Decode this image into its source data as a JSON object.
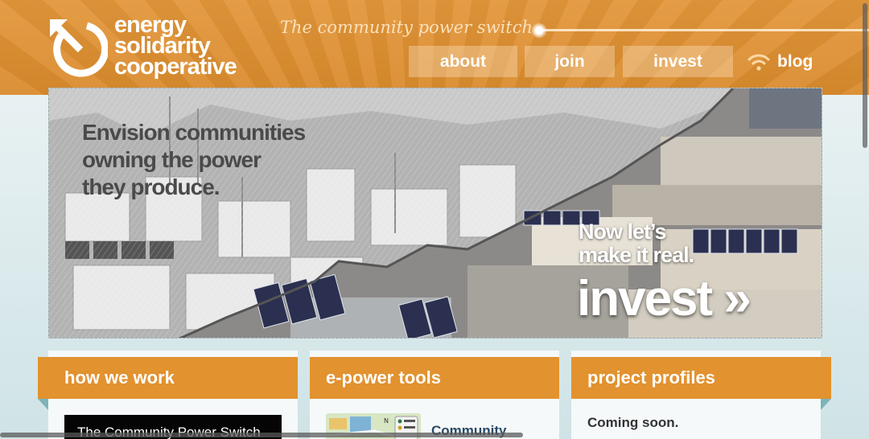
{
  "brand": {
    "name_lines": [
      "energy",
      "solidarity",
      "cooperative"
    ],
    "tagline": "The community power switch"
  },
  "nav": {
    "about": "about",
    "join": "join",
    "invest": "invest",
    "blog": "blog"
  },
  "hero": {
    "left_lines": [
      "Envision communities",
      "owning the power",
      "they produce."
    ],
    "right_lines": [
      "Now let’s",
      "make it real."
    ],
    "cta": "invest »"
  },
  "cards": [
    {
      "title": "how we work",
      "video_label": "The Community Power Switch"
    },
    {
      "title": "e-power tools",
      "item_label": "Community"
    },
    {
      "title": "project profiles",
      "status": "Coming soon."
    }
  ],
  "colors": {
    "brand_orange": "#e2922f",
    "accent_teal": "#7db4b9",
    "link_blue": "#2b4a66"
  }
}
